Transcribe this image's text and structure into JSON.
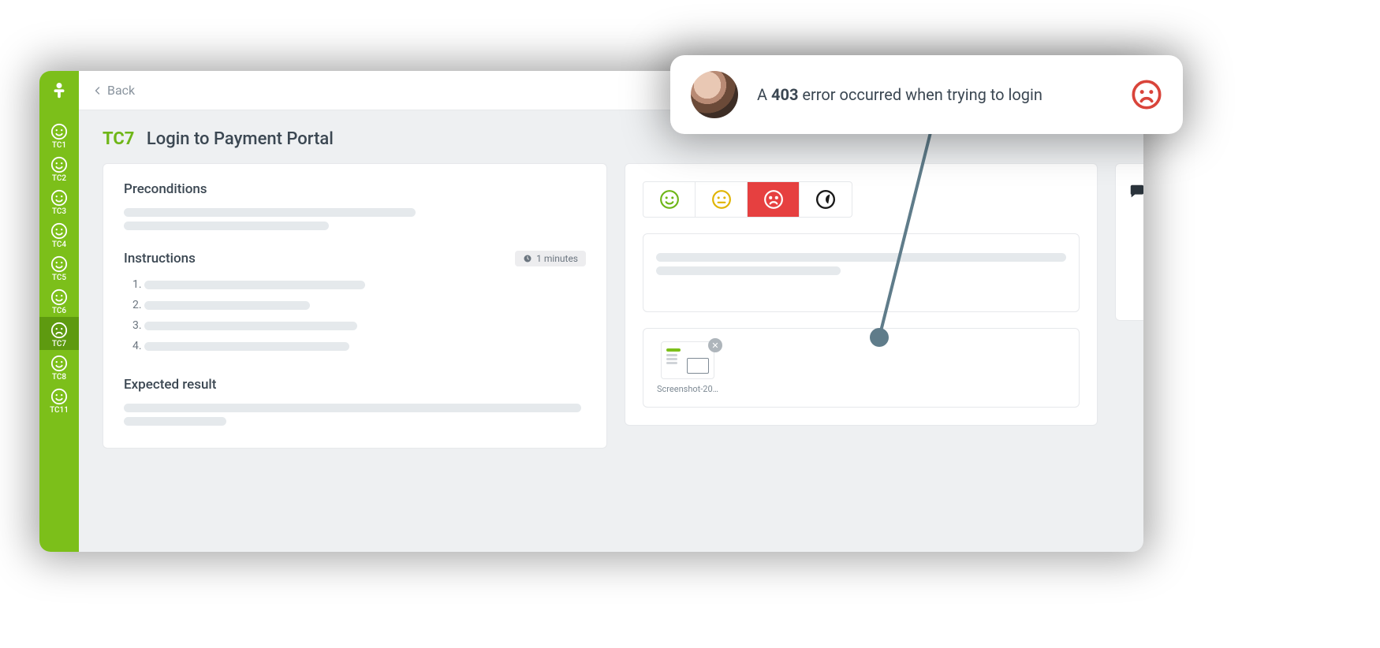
{
  "sidebar": {
    "items": [
      {
        "id": "TC1"
      },
      {
        "id": "TC2"
      },
      {
        "id": "TC3"
      },
      {
        "id": "TC4"
      },
      {
        "id": "TC5"
      },
      {
        "id": "TC6"
      },
      {
        "id": "TC7"
      },
      {
        "id": "TC8"
      },
      {
        "id": "TC11"
      }
    ],
    "active_id": "TC7"
  },
  "topbar": {
    "back_label": "Back"
  },
  "title": {
    "tc_id": "TC7",
    "name": "Login to Payment Portal"
  },
  "sections": {
    "preconditions_label": "Preconditions",
    "instructions_label": "Instructions",
    "expected_label": "Expected result",
    "duration_label": "1 minutes"
  },
  "instructions_count": 4,
  "ratings": {
    "options": [
      "pass",
      "warn",
      "fail",
      "blocked"
    ],
    "selected": "fail"
  },
  "attachment": {
    "filename": "Screenshot-20…"
  },
  "toast": {
    "prefix": "A ",
    "bold": "403",
    "suffix": " error occurred when trying to login"
  }
}
